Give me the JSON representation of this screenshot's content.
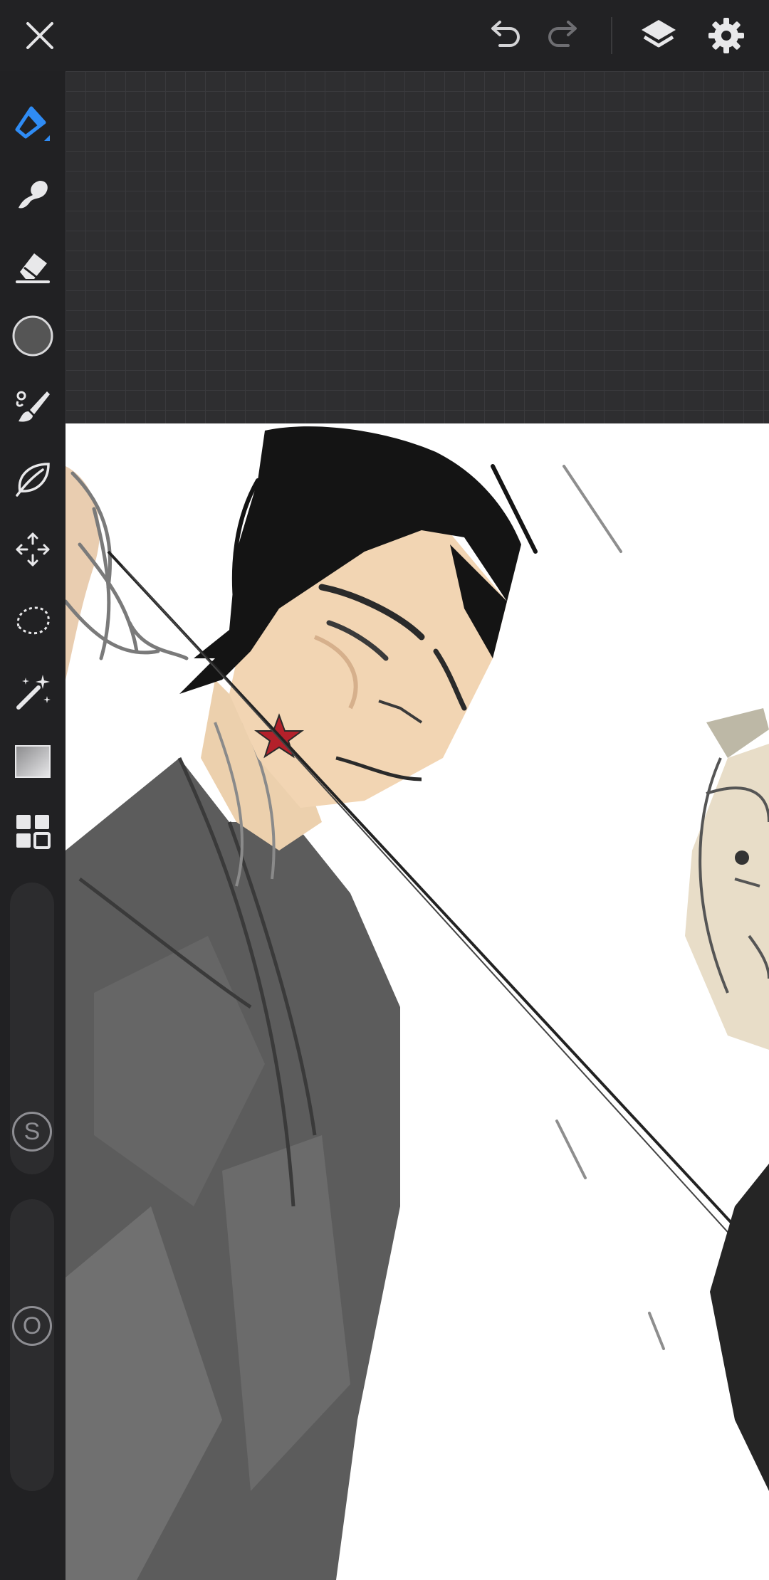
{
  "app": {
    "accent_color": "#2f8cf5",
    "toolbar_bg": "#222224",
    "canvas_bg": "#ffffff"
  },
  "topbar": {
    "close": {
      "icon": "close-icon"
    },
    "undo": {
      "icon": "undo-icon"
    },
    "redo": {
      "icon": "redo-icon",
      "enabled": false
    },
    "layers": {
      "icon": "layers-icon"
    },
    "settings": {
      "icon": "gear-icon"
    }
  },
  "tools": [
    {
      "id": "pen",
      "icon": "pen-icon",
      "active": true
    },
    {
      "id": "smudge",
      "icon": "smudge-icon",
      "active": false
    },
    {
      "id": "eraser",
      "icon": "eraser-icon",
      "active": false
    },
    {
      "id": "color",
      "icon": "color-swatch-icon",
      "value": "#555555"
    },
    {
      "id": "brush",
      "icon": "brush-icon",
      "active": false
    },
    {
      "id": "liquify",
      "icon": "leaf-icon",
      "active": false
    },
    {
      "id": "transform",
      "icon": "move-icon",
      "active": false
    },
    {
      "id": "selection",
      "icon": "lasso-icon",
      "active": false
    },
    {
      "id": "magic-wand",
      "icon": "magic-wand-icon",
      "active": false
    },
    {
      "id": "gradient",
      "icon": "gradient-icon",
      "active": false
    },
    {
      "id": "more",
      "icon": "grid-icon",
      "active": false
    }
  ],
  "sliders": {
    "size": {
      "label": "S"
    },
    "opacity": {
      "label": "O"
    }
  }
}
